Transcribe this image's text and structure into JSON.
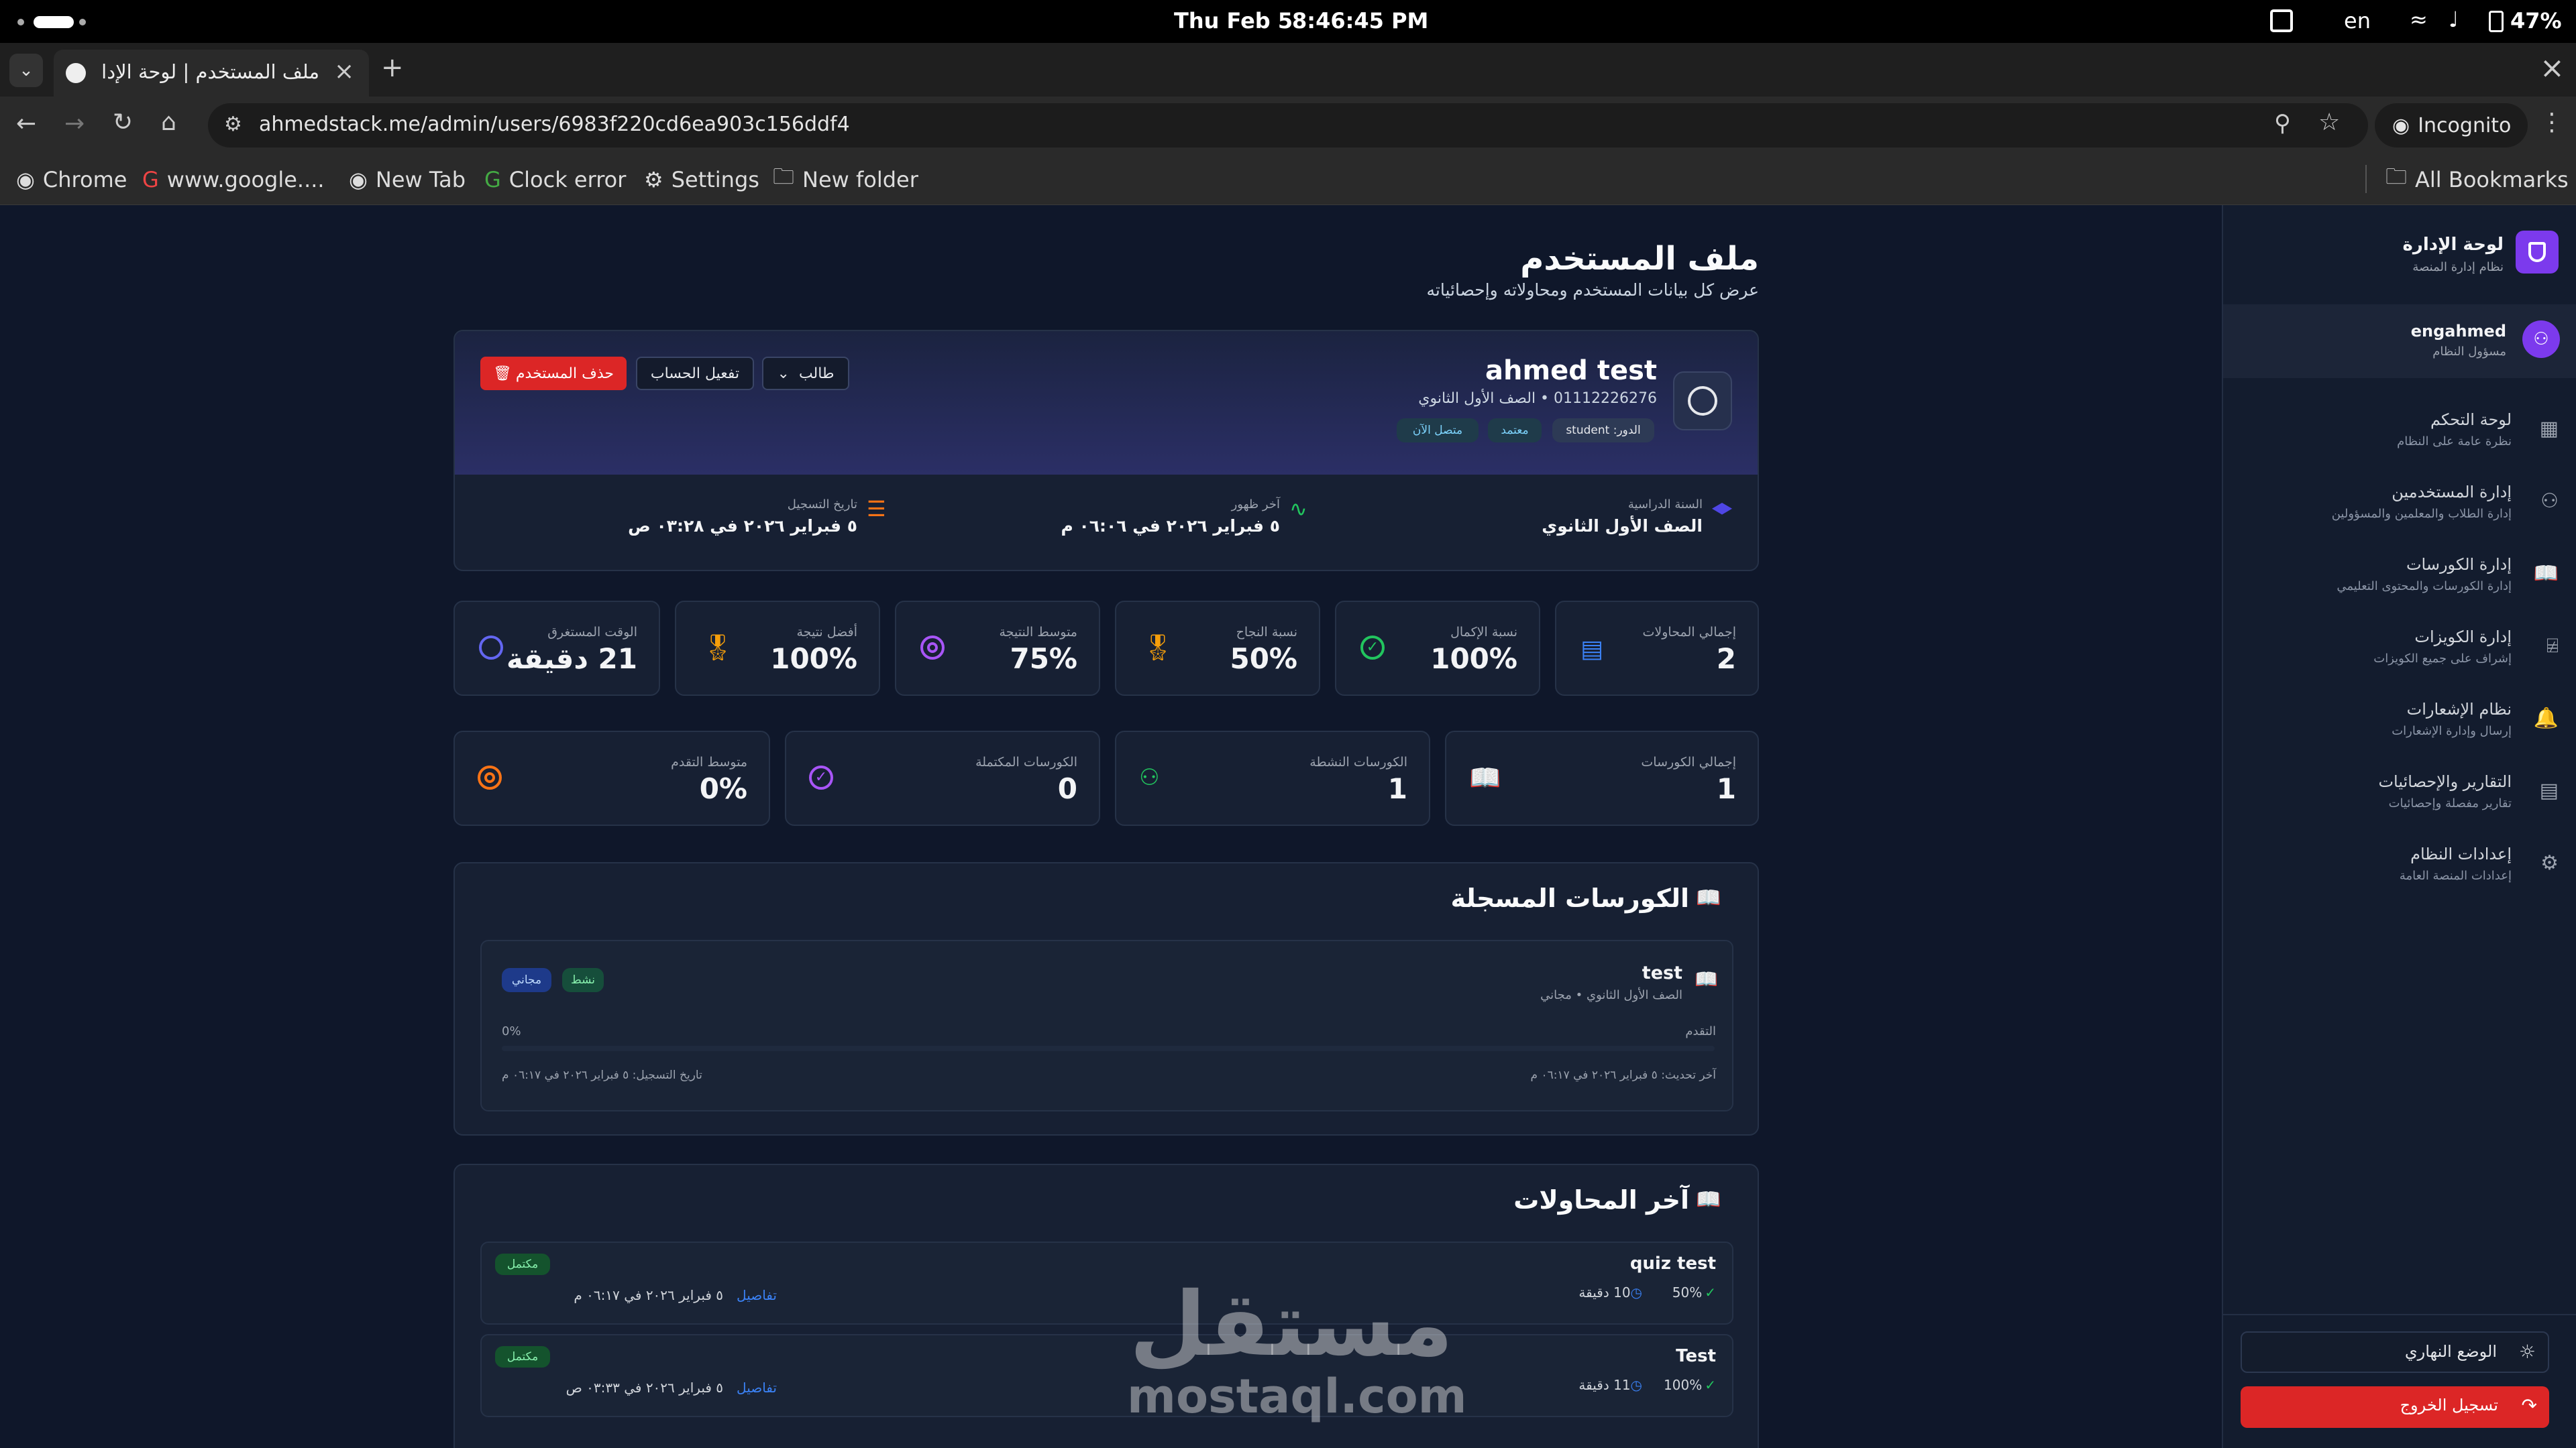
{
  "os": {
    "date": "Thu Feb 5",
    "time": "8:46:45 PM",
    "lang": "en",
    "battery": "47%"
  },
  "browser": {
    "tab_title": "ملف المستخدم | لوحة الإدا",
    "url": "ahmedstack.me/admin/users/6983f220cd6ea903c156ddf4",
    "incognito_label": "Incognito",
    "bookmarks": [
      "Chrome",
      "www.google....",
      "New Tab",
      "Clock error",
      "Settings",
      "New folder"
    ],
    "all_bookmarks": "All Bookmarks"
  },
  "page": {
    "title": "ملف المستخدم",
    "subtitle": "عرض كل بيانات المستخدم ومحاولاته وإحصائياته"
  },
  "profile": {
    "name": "ahmed test",
    "phone_grade": "01112226276 • الصف الأول الثانوي",
    "badges": {
      "role": "الدور: student",
      "approved": "معتمد",
      "online": "متصل الآن"
    },
    "role_select": "طالب",
    "activate_button": "تفعيل الحساب",
    "delete_button": "حذف المستخدم",
    "info": {
      "year_label": "السنة الدراسية",
      "year_value": "الصف الأول الثانوي",
      "last_seen_label": "آخر ظهور",
      "last_seen_value": "٥ فبراير ٢٠٢٦ في ٠٦:٠٦ م",
      "registered_label": "تاريخ التسجيل",
      "registered_value": "٥ فبراير ٢٠٢٦ في ٠٣:٢٨ ص"
    }
  },
  "stats_row1": [
    {
      "label": "إجمالي المحاولات",
      "value": "2"
    },
    {
      "label": "نسبة الإكمال",
      "value": "100%"
    },
    {
      "label": "نسبة النجاح",
      "value": "50%"
    },
    {
      "label": "متوسط النتيجة",
      "value": "75%"
    },
    {
      "label": "أفضل نتيجة",
      "value": "100%"
    },
    {
      "label": "الوقت المستغرق",
      "value": "21 دقيقة"
    }
  ],
  "stats_row2": [
    {
      "label": "إجمالي الكورسات",
      "value": "1"
    },
    {
      "label": "الكورسات النشطة",
      "value": "1"
    },
    {
      "label": "الكورسات المكتملة",
      "value": "0"
    },
    {
      "label": "متوسط التقدم",
      "value": "0%"
    }
  ],
  "courses": {
    "title": "الكورسات المسجلة",
    "items": [
      {
        "name": "test",
        "meta": "الصف الأول الثانوي • مجاني",
        "status": "نشط",
        "price": "مجاني",
        "progress_label": "التقدم",
        "progress_value": "0%",
        "progress": 0,
        "updated": "آخر تحديث: ٥ فبراير ٢٠٢٦ في ٠٦:١٧ م",
        "registered": "تاريخ التسجيل: ٥ فبراير ٢٠٢٦ في ٠٦:١٧ م"
      }
    ]
  },
  "attempts": {
    "title": "آخر المحاولات",
    "items": [
      {
        "name": "quiz test",
        "score": "50%",
        "duration": "10 دقيقة",
        "status": "مكتمل",
        "date": "٥ فبراير ٢٠٢٦ في ٠٦:١٧ م",
        "details": "تفاصيل"
      },
      {
        "name": "Test",
        "score": "100%",
        "duration": "11 دقيقة",
        "status": "مكتمل",
        "date": "٥ فبراير ٢٠٢٦ في ٠٣:٣٣ ص",
        "details": "تفاصيل"
      }
    ]
  },
  "watermark": {
    "arabic": "مستقل",
    "latin": "mostaql.com"
  },
  "sidebar": {
    "brand_title": "لوحة الإدارة",
    "brand_sub": "نظام إدارة المنصة",
    "user_name": "engahmed",
    "user_role": "مسؤول النظام",
    "items": [
      {
        "title": "لوحة التحكم",
        "sub": "نظرة عامة على النظام"
      },
      {
        "title": "إدارة المستخدمين",
        "sub": "إدارة الطلاب والمعلمين والمسؤولين"
      },
      {
        "title": "إدارة الكورسات",
        "sub": "إدارة الكورسات والمحتوى التعليمي"
      },
      {
        "title": "إدارة الكويزات",
        "sub": "إشراف على جميع الكويزات"
      },
      {
        "title": "نظام الإشعارات",
        "sub": "إرسال وإدارة الإشعارات"
      },
      {
        "title": "التقارير والإحصائيات",
        "sub": "تقارير مفصلة وإحصائيات"
      },
      {
        "title": "إعدادات النظام",
        "sub": "إعدادات المنصة العامة"
      }
    ],
    "theme_label": "الوضع النهاري",
    "logout_label": "تسجيل الخروج"
  },
  "colors": {
    "accent": "#7c3aed",
    "danger": "#dc2626",
    "success": "#22c55e",
    "blue": "#3b82f6",
    "amber": "#f59e0b"
  }
}
